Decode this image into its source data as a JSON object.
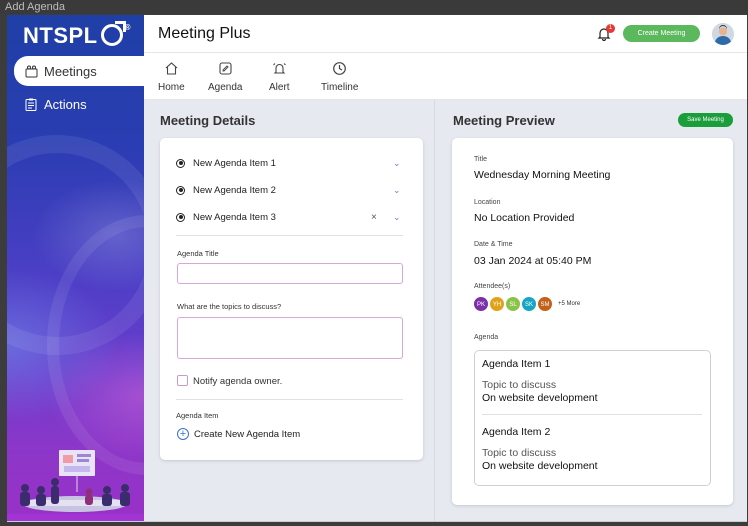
{
  "window": {
    "title": "Add Agenda"
  },
  "sidebar": {
    "logo": "NTSPL",
    "logo_reg": "®",
    "items": [
      {
        "label": "Meetings",
        "icon": "meetings-icon",
        "active": true
      },
      {
        "label": "Actions",
        "icon": "actions-icon",
        "active": false
      }
    ]
  },
  "header": {
    "title": "Meeting Plus",
    "notification_count": "1",
    "create_button": "Create Meeting"
  },
  "toolbar": {
    "items": [
      {
        "label": "Home",
        "icon": "home-icon"
      },
      {
        "label": "Agenda",
        "icon": "agenda-icon"
      },
      {
        "label": "Alert",
        "icon": "alert-icon"
      },
      {
        "label": "Timeline",
        "icon": "timeline-icon"
      }
    ]
  },
  "details": {
    "title": "Meeting Details",
    "agenda_items": [
      "New Agenda  Item 1",
      "New Agenda  Item 2",
      "New Agenda  Item 3"
    ],
    "agenda_title_label": "Agenda Title",
    "agenda_title_value": "",
    "topics_label": "What are the topics to discuss?",
    "topics_value": "",
    "notify_label": "Notify agenda owner.",
    "agenda_item_label": "Agenda Item",
    "create_item_label": "Create New Agenda Item"
  },
  "preview": {
    "title": "Meeting Preview",
    "save_button": "Save Meeting",
    "title_label": "Title",
    "title_value": "Wednesday Morning Meeting",
    "location_label": "Location",
    "location_value": "No Location Provided",
    "datetime_label": "Date & Time",
    "datetime_value": "03 Jan 2024 at 05:40 PM",
    "attendees_label": "Attendee(s)",
    "attendees": [
      {
        "initials": "PK",
        "color": "#7b2fa8"
      },
      {
        "initials": "YH",
        "color": "#e0a21a"
      },
      {
        "initials": "SL",
        "color": "#8bc34a"
      },
      {
        "initials": "SK",
        "color": "#17a5c4"
      },
      {
        "initials": "SM",
        "color": "#c2611a"
      }
    ],
    "attendees_more": "+5 More",
    "agenda_label": "Agenda",
    "agenda": [
      {
        "title": "Agenda  Item 1",
        "topic_label": "Topic to discuss",
        "topic_value": "On website development"
      },
      {
        "title": "Agenda  Item 2",
        "topic_label": "Topic to discuss",
        "topic_value": "On website development"
      }
    ]
  }
}
